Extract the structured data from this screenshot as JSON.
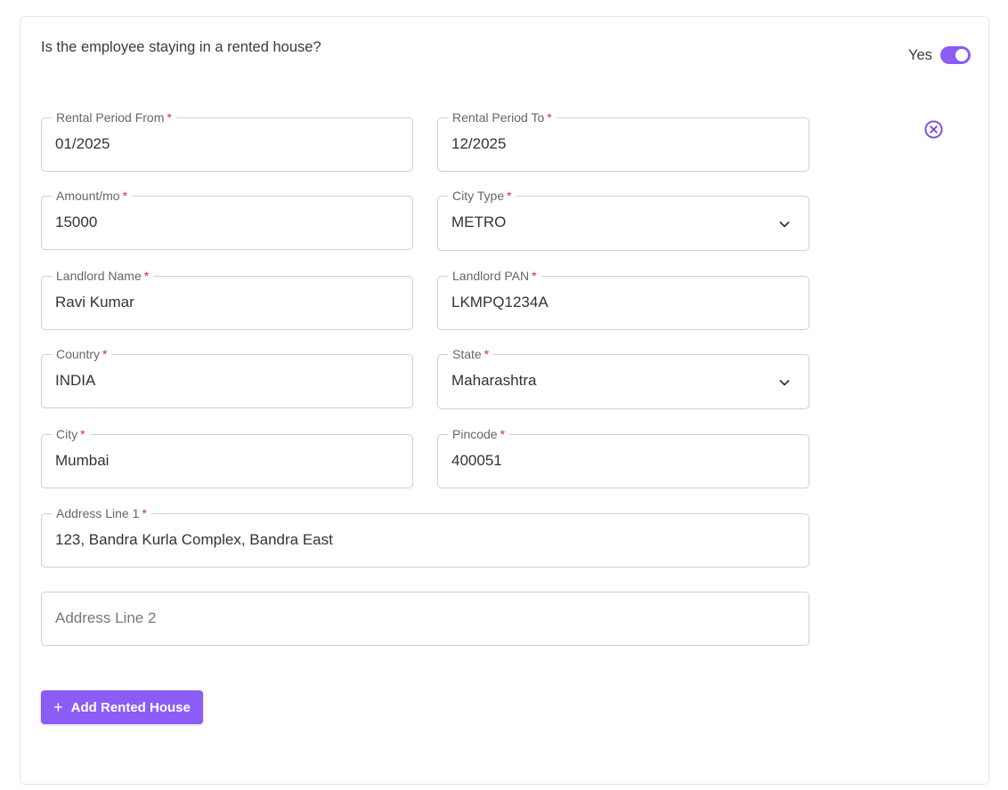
{
  "question": "Is the employee staying in a rented house?",
  "toggle": {
    "label": "Yes",
    "on": true,
    "color": "#8b5cf6"
  },
  "remove_icon": "close-circle-icon",
  "fields": {
    "rental_from": {
      "label": "Rental Period From",
      "value": "01/2025"
    },
    "rental_to": {
      "label": "Rental Period To",
      "value": "12/2025"
    },
    "amount": {
      "label": "Amount/mo",
      "value": "15000"
    },
    "city_type": {
      "label": "City Type",
      "value": "METRO"
    },
    "landlord_name": {
      "label": "Landlord Name",
      "value": "Ravi Kumar"
    },
    "landlord_pan": {
      "label": "Landlord PAN",
      "value": "LKMPQ1234A"
    },
    "country": {
      "label": "Country",
      "value": "INDIA"
    },
    "state": {
      "label": "State",
      "value": "Maharashtra"
    },
    "city": {
      "label": "City",
      "value": "Mumbai"
    },
    "pincode": {
      "label": "Pincode",
      "value": "400051"
    },
    "address1": {
      "label": "Address Line 1",
      "value": "123, Bandra Kurla Complex, Bandra East"
    },
    "address2": {
      "placeholder": "Address Line 2"
    }
  },
  "required_marker": "*",
  "add_button": {
    "icon": "+",
    "label": "Add Rented House"
  },
  "colors": {
    "accent": "#8b5cf6",
    "required": "#d32f2f",
    "border": "#cfcfd4"
  }
}
